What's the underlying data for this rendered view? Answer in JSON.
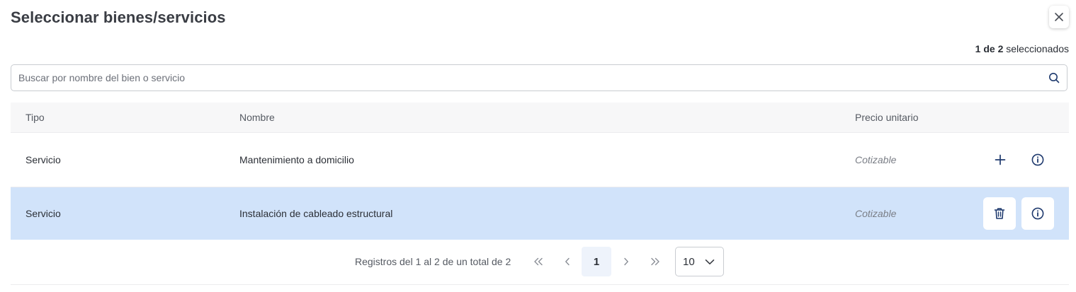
{
  "dialog": {
    "title": "Seleccionar bienes/servicios",
    "selected_count": "1 de 2",
    "selected_suffix": " seleccionados"
  },
  "search": {
    "placeholder": "Buscar por nombre del bien o servicio",
    "value": ""
  },
  "table": {
    "headers": {
      "tipo": "Tipo",
      "nombre": "Nombre",
      "precio": "Precio unitario"
    },
    "rows": [
      {
        "tipo": "Servicio",
        "nombre": "Mantenimiento a domicilio",
        "precio": "Cotizable",
        "selected": false,
        "action_icon": "plus-icon"
      },
      {
        "tipo": "Servicio",
        "nombre": "Instalación de cableado estructural",
        "precio": "Cotizable",
        "selected": true,
        "action_icon": "trash-icon"
      }
    ]
  },
  "pagination": {
    "info": "Registros del 1 al 2 de un total de 2",
    "current_page": "1",
    "page_size": "10"
  },
  "colors": {
    "accent": "#1f3a6e",
    "selected_row": "#d1e3fa"
  }
}
